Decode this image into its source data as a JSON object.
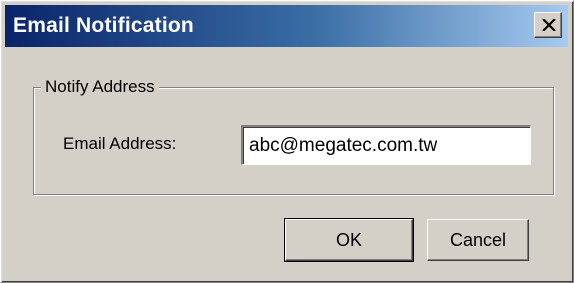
{
  "window": {
    "title": "Email Notification",
    "close_icon": "close-x-icon"
  },
  "group": {
    "legend": "Notify Address"
  },
  "email_field": {
    "label": "Email Address:",
    "value": "abc@megatec.com.tw"
  },
  "buttons": {
    "ok_label": "OK",
    "cancel_label": "Cancel"
  },
  "colors": {
    "dialog_bg": "#d4d0c8",
    "title_gradient_start": "#0a246a",
    "title_gradient_end": "#a6caf0",
    "title_text": "#ffffff"
  }
}
